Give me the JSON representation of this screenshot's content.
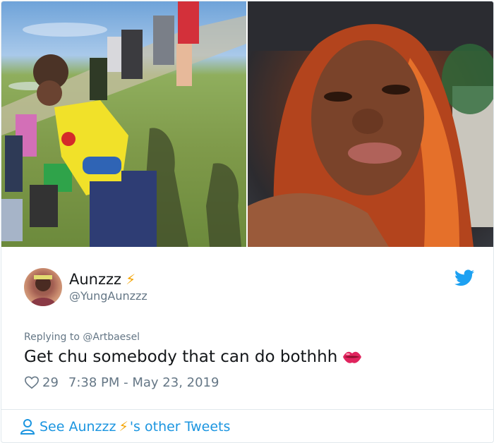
{
  "tweet": {
    "author": {
      "display_name": "Aunzzz",
      "display_name_emoji": "⚡",
      "handle": "@YungAunzzz",
      "avatar_icon": "avatar-photo"
    },
    "reply_context": "Replying to @Artbaesel",
    "text": "Get chu somebody that can do bothhh",
    "text_emoji": "kiss-mark-icon",
    "likes": "29",
    "timestamp": "7:38 PM - May 23, 2019",
    "media": [
      {
        "name": "photo-outdoor-group"
      },
      {
        "name": "photo-selfie"
      }
    ]
  },
  "footer": {
    "link_prefix": "See Aunzzz",
    "link_emoji": "⚡",
    "link_suffix": "'s other Tweets"
  },
  "colors": {
    "twitter_blue": "#1da1f2",
    "link_blue": "#1b95e0",
    "muted_text": "#657786",
    "bolt": "#f4a300",
    "lips": "#e0245e"
  }
}
